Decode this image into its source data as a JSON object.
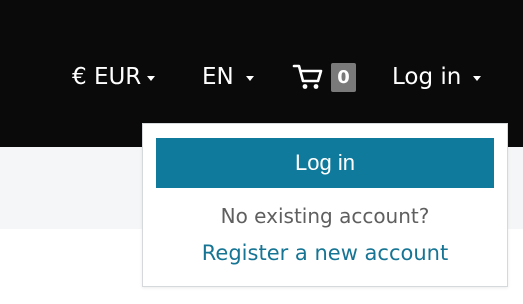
{
  "header": {
    "currency": {
      "label": "€ EUR"
    },
    "language": {
      "label": "EN"
    },
    "cart": {
      "count": "0",
      "icon": "cart-icon"
    },
    "login": {
      "label": "Log in"
    }
  },
  "login_dropdown": {
    "login_button": "Log in",
    "no_account_text": "No existing account?",
    "register_link": "Register a new account"
  },
  "colors": {
    "header_bg": "#0a0a0a",
    "primary_button": "#0f7a9b",
    "link": "#167594",
    "cart_badge": "#7a7a7a"
  }
}
